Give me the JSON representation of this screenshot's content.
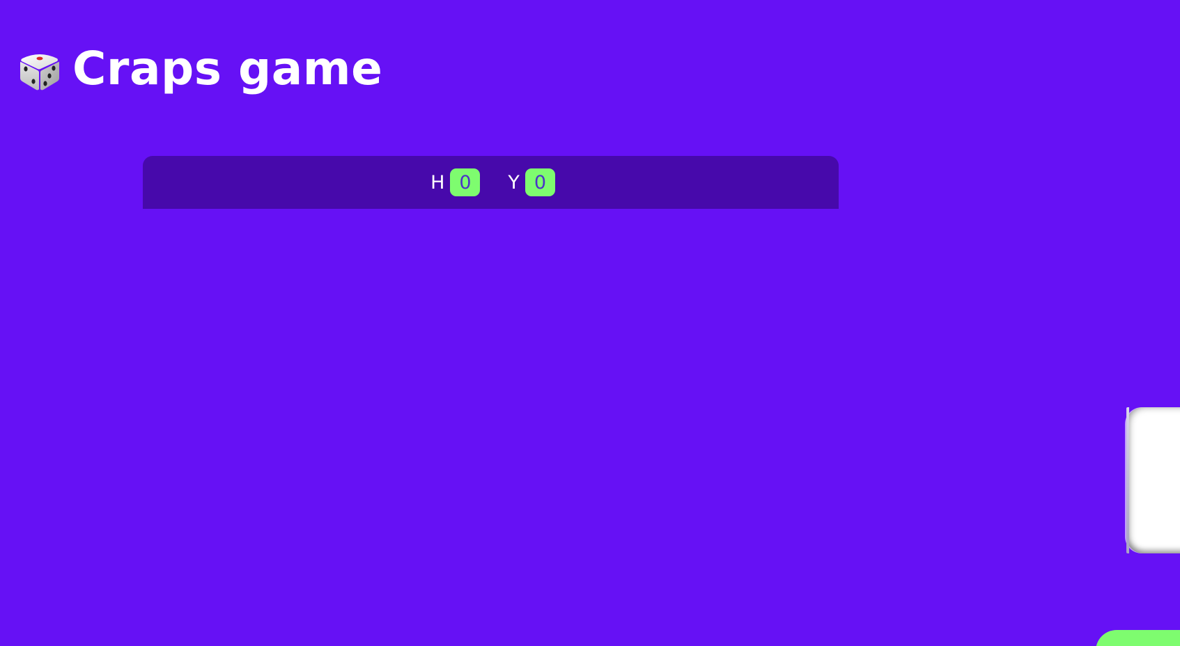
{
  "header": {
    "icon": "dice-icon",
    "title": "Craps game"
  },
  "scoreboard": {
    "players": [
      {
        "label": "H",
        "score": "0"
      },
      {
        "label": "Y",
        "score": "0"
      }
    ]
  },
  "colors": {
    "background": "#6611f5",
    "scoreboard": "#4709ab",
    "badge": "#7efc6f",
    "badge_text": "#4b33c8",
    "title": "#ffffff"
  }
}
